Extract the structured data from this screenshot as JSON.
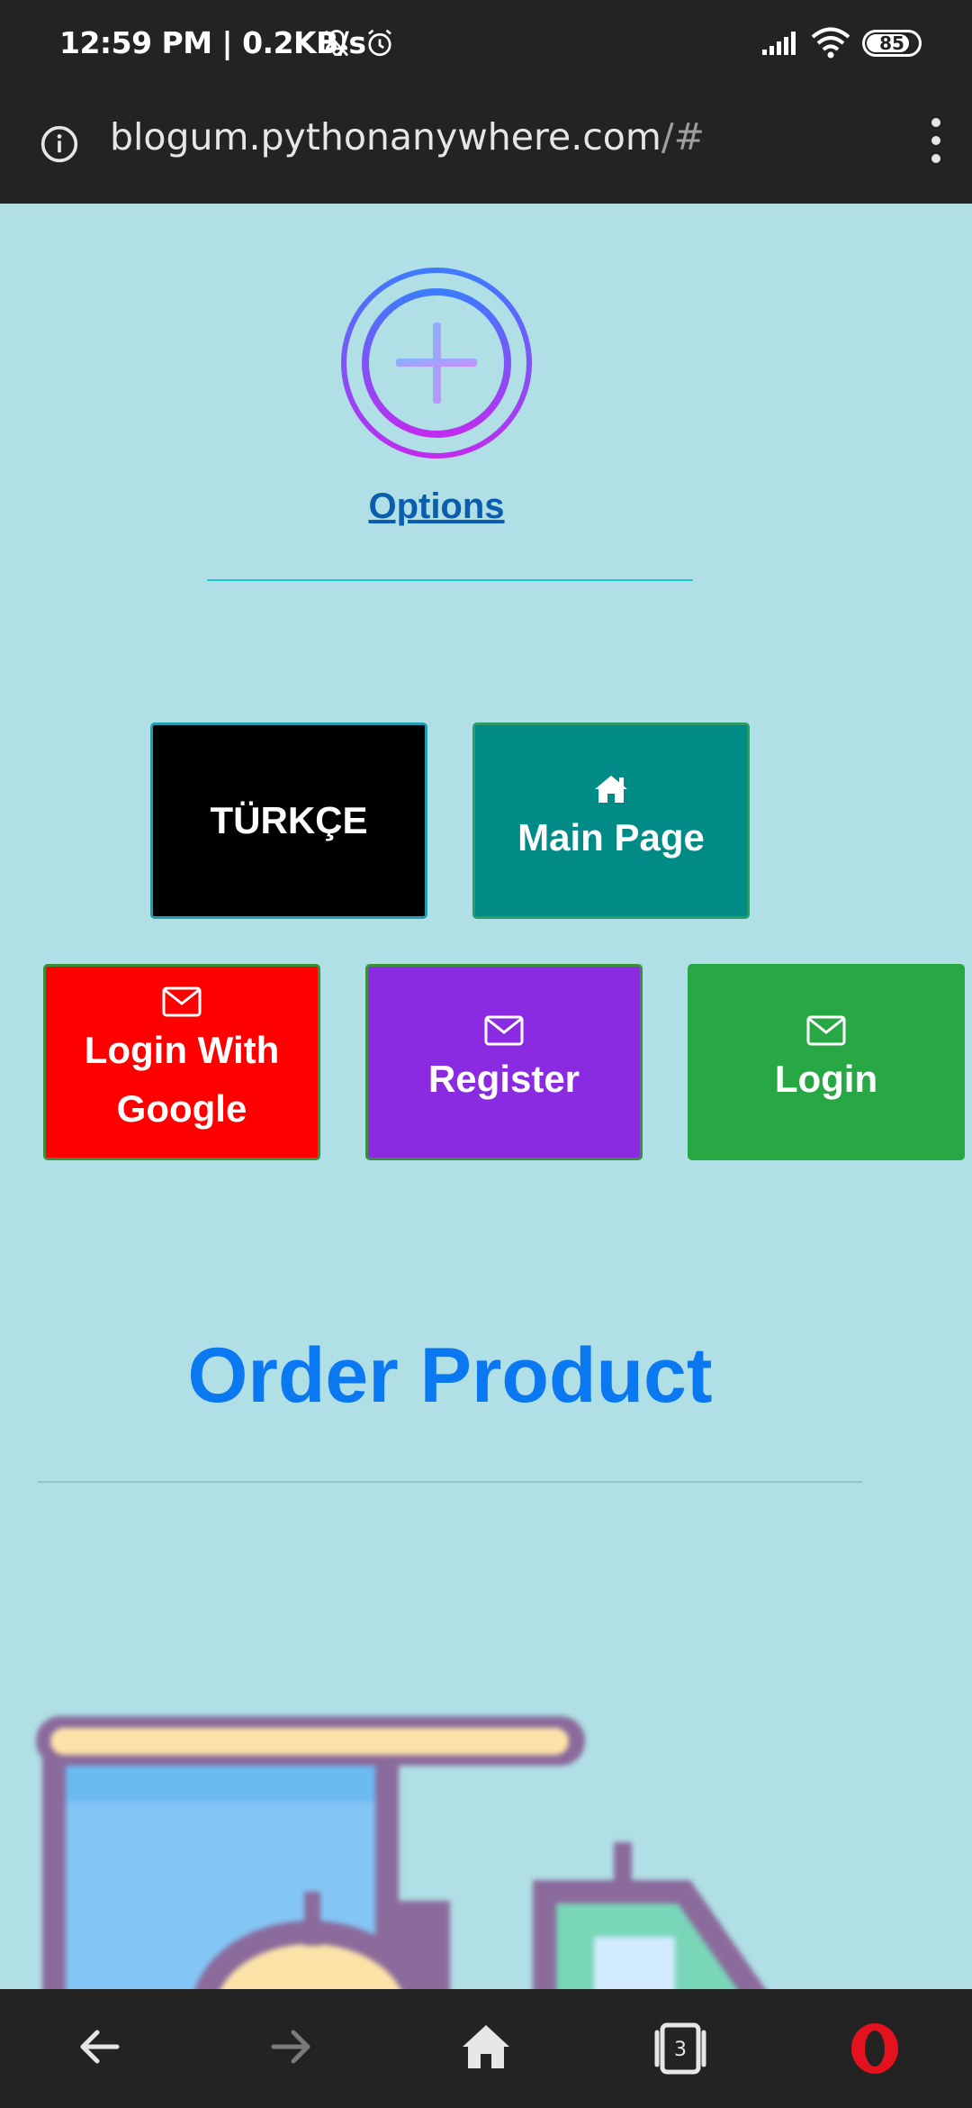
{
  "status_bar": {
    "time": "12:59 PM | 0.2KB/s",
    "battery": "85",
    "battery_level_percent": 85,
    "icons": [
      "muted-bell-icon",
      "alarm-icon",
      "signal-icon",
      "wifi-icon",
      "battery-icon"
    ]
  },
  "browser": {
    "url_host": "blogum.pythonanywhere.com",
    "url_path": "/#",
    "icons": [
      "info-icon",
      "menu-dots-icon"
    ]
  },
  "page": {
    "options_label": "Options",
    "logo_icon": "plus-circle-icon",
    "buttons": {
      "turkce": "TÜRKÇE",
      "main_page": "Main Page",
      "login_google_line1": "Login With",
      "login_google_line2": "Google",
      "register": "Register",
      "login": "Login"
    },
    "button_icons": {
      "main_page": "home-icon",
      "login_google": "envelope-icon",
      "register": "envelope-icon",
      "login": "envelope-icon"
    },
    "order_title": "Order Product",
    "product_image": "delivery-truck-illustration"
  },
  "nav_bar": {
    "tab_count": "3",
    "icons": [
      "back-arrow-icon",
      "forward-arrow-icon",
      "home-icon",
      "tabs-icon",
      "opera-icon"
    ]
  },
  "colors": {
    "background": "#b0dfe5",
    "status_bar": "#232323",
    "turkce_button": "#000000",
    "main_page_button": "#008b87",
    "google_button": "#ff0000",
    "register_button": "#8a2be2",
    "login_button": "#28a745",
    "order_title": "#0a78f0",
    "options_link": "#0b5dae"
  }
}
